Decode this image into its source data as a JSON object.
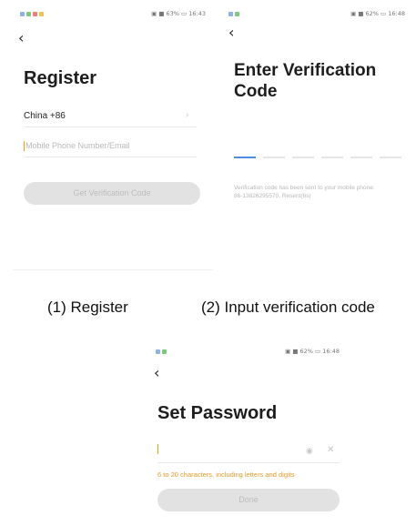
{
  "screens": {
    "register": {
      "status_left": "ᵀᵀ ▢ ◌",
      "status_right": "▣ ■ 63% ▭ 16:43",
      "back": "‹",
      "title": "Register",
      "country": "China +86",
      "country_arrow": "›",
      "phone_placeholder": "Mobile Phone Number/Email",
      "button": "Get Verification Code"
    },
    "verify": {
      "status_left": "ᵀᵀ ▢ ◌",
      "status_right": "▣ ■ 62% ▭ 16:48",
      "back": "‹",
      "title_line1": "Enter Verification",
      "title_line2": "Code",
      "hint_line1": "Verification code has been sent to your mobile phone:",
      "hint_line2": "86-13826295570. Resent(6s)"
    },
    "password": {
      "status_left": "ᵀᵀ ▢ ◌",
      "status_right": "▣ ■ 62% ▭ 16:48",
      "back": "‹",
      "title": "Set Password",
      "warning": "6 to 20 characters, including letters and digits",
      "button": "Done",
      "eye_icon": "◉",
      "clear_icon": "✕"
    }
  },
  "captions": {
    "register": "(1) Register",
    "verify": "(2) Input verification code"
  },
  "colors": {
    "accent": "#4a90e2",
    "warning": "#e59a2b",
    "button_bg": "#e2e2e2"
  }
}
